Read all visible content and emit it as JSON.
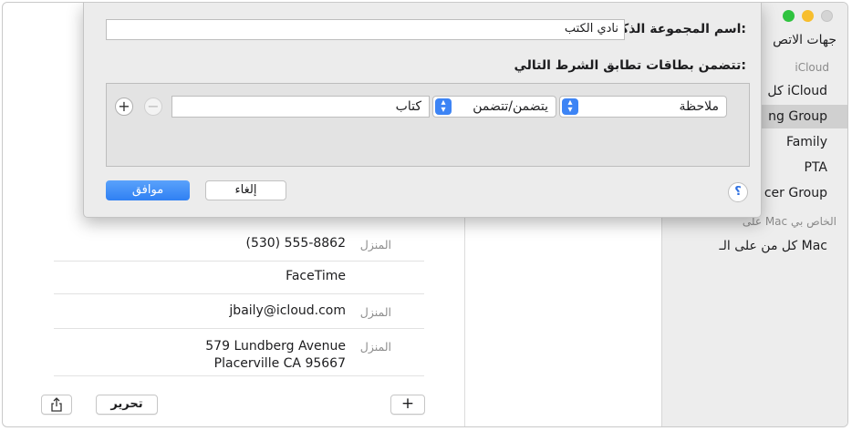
{
  "sidebar": {
    "items": [
      {
        "label": "جهات الاتص",
        "type": "item"
      },
      {
        "label": "iCloud",
        "type": "header"
      },
      {
        "label": "كل iCloud",
        "type": "item"
      },
      {
        "label": "ng Group",
        "type": "item",
        "selected": true
      },
      {
        "label": "Family",
        "type": "item"
      },
      {
        "label": "PTA",
        "type": "item"
      },
      {
        "label": "cer Group",
        "type": "item"
      },
      {
        "label": "على Mac الخاص بي",
        "type": "header"
      },
      {
        "label": "كل من على الـ Mac",
        "type": "item"
      }
    ]
  },
  "detail": {
    "rows": [
      {
        "label": "المنزل",
        "value": "(530) 555-8862"
      },
      {
        "label": "",
        "value": "FaceTime"
      },
      {
        "label": "المنزل",
        "value": "jbaily@icloud.com"
      },
      {
        "label": "المنزل",
        "value_line1": "579 Lundberg Avenue",
        "value_line2": "Placerville CA 95667"
      }
    ],
    "add_label": "+",
    "edit_label": "تحرير",
    "share_icon": "share-icon"
  },
  "dialog": {
    "name_label": "اسم المجموعة الذكية:",
    "name_value": "نادي الكتب",
    "conditions_label": "تتضمن بطاقات تطابق الشرط التالي:",
    "rule": {
      "field": "ملاحظة",
      "operator": "يتضمن/تتضمن",
      "value": "كتاب"
    },
    "remove_label": "−",
    "add_label": "+",
    "help_label": "؟",
    "cancel_label": "إلغاء",
    "ok_label": "موافق"
  },
  "colors": {
    "accent": "#2f80f3",
    "sidebar_bg": "#ededed",
    "selection": "#d0d0d0"
  }
}
